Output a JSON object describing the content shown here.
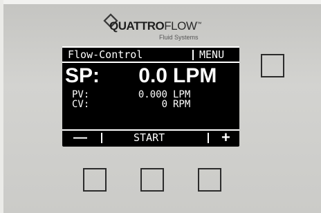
{
  "logo": {
    "brand_bold": "QUATTRO",
    "brand_thin": "FLOW",
    "trademark": "™",
    "subtitle": "Fluid Systems"
  },
  "display": {
    "header": {
      "title": "Flow-Control",
      "menu": "MENU"
    },
    "setpoint": {
      "label": "SP:",
      "value": "0.0",
      "unit": "LPM"
    },
    "process_value": {
      "label": "PV:",
      "value": "0.000",
      "unit": "LPM"
    },
    "control_value": {
      "label": "CV:",
      "value": "0",
      "unit": "RPM"
    },
    "softkeys": {
      "left": "—",
      "center": "START",
      "right": "+"
    }
  },
  "colors": {
    "display_background": "#000000",
    "display_text": "#ffffff",
    "panel": "#cbcbc8"
  }
}
